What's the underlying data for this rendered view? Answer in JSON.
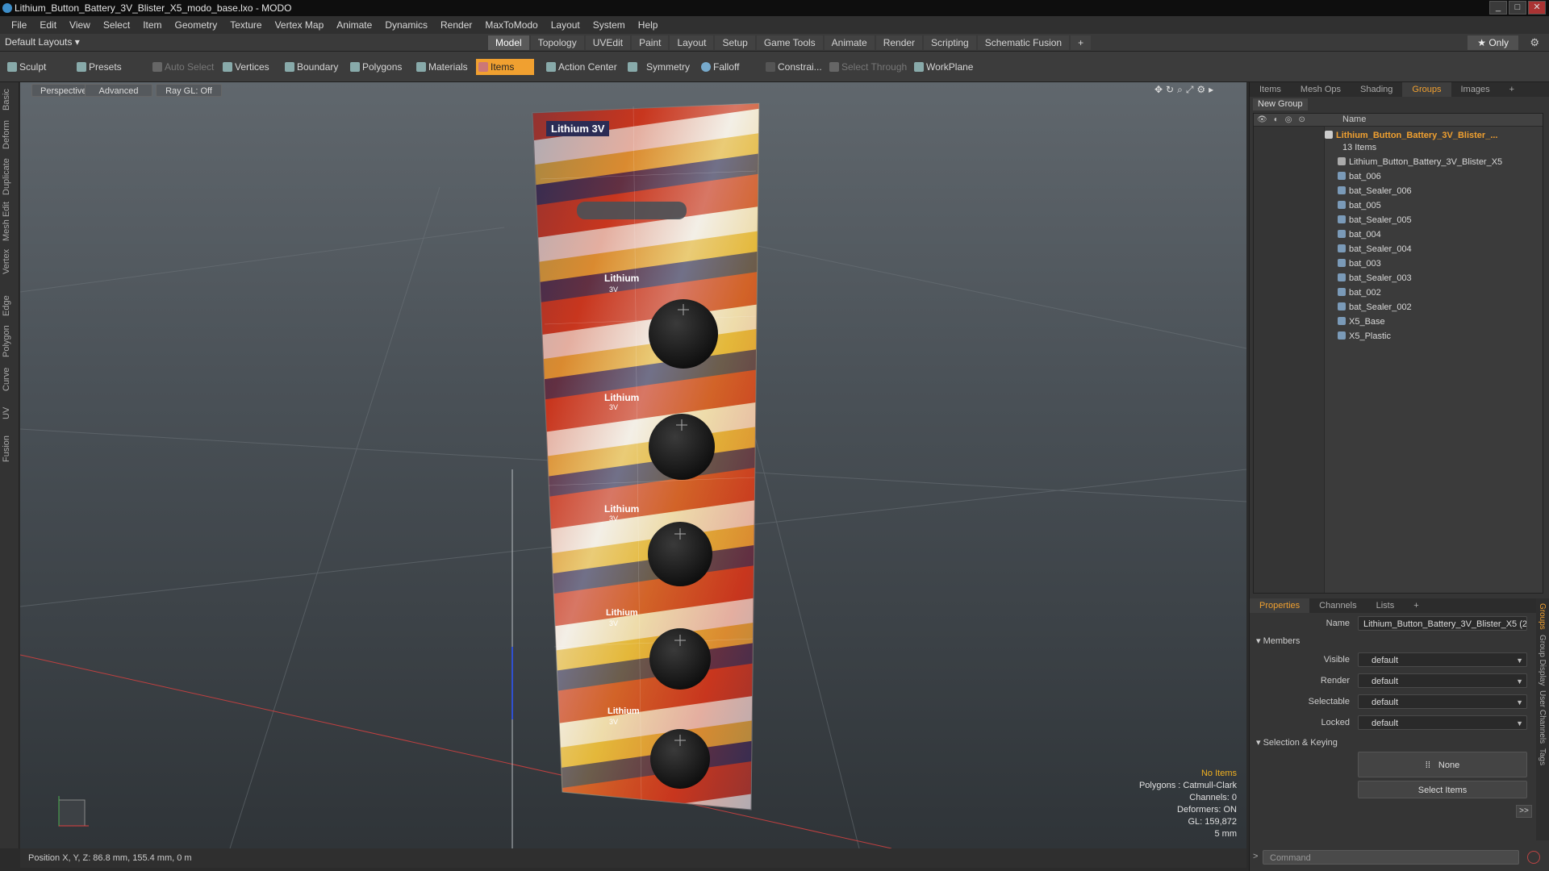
{
  "title": "Lithium_Button_Battery_3V_Blister_X5_modo_base.lxo - MODO",
  "menu": [
    "File",
    "Edit",
    "View",
    "Select",
    "Item",
    "Geometry",
    "Texture",
    "Vertex Map",
    "Animate",
    "Dynamics",
    "Render",
    "MaxToModo",
    "Layout",
    "System",
    "Help"
  ],
  "layout_dropdown": "Default Layouts ▾",
  "tabs": [
    "Model",
    "Topology",
    "UVEdit",
    "Paint",
    "Layout",
    "Setup",
    "Game Tools",
    "Animate",
    "Render",
    "Scripting",
    "Schematic Fusion"
  ],
  "only_label": "★ Only",
  "toolbar": {
    "sculpt": "Sculpt",
    "presets": "Presets",
    "auto_select": "Auto Select",
    "vertices": "Vertices",
    "boundary": "Boundary",
    "polygons": "Polygons",
    "materials": "Materials",
    "items": "Items",
    "action_center": "Action Center",
    "symmetry": "Symmetry",
    "falloff": "Falloff",
    "constraints": "Constrai...",
    "select_through": "Select Through",
    "workplane": "WorkPlane"
  },
  "left_tabs": [
    "Basic",
    "Deform",
    "Duplicate",
    "Mesh Edit",
    "Vertex",
    "Edge",
    "Polygon",
    "Curve",
    "UV",
    "Fusion"
  ],
  "viewport": {
    "perspective": "Perspective",
    "advanced": "Advanced",
    "raygl": "Ray GL: Off",
    "product_label": "Lithium  3V",
    "battery_label": "Lithium",
    "battery_volt": "3V",
    "info": {
      "no_items": "No Items",
      "polygons": "Polygons : Catmull-Clark",
      "channels": "Channels: 0",
      "deformers": "Deformers: ON",
      "gl": "GL: 159,872",
      "scale": "5 mm"
    }
  },
  "status": "Position X, Y, Z:  86.8 mm, 155.4 mm, 0 m",
  "panel_tabs": [
    "Items",
    "Mesh Ops",
    "Shading",
    "Groups",
    "Images"
  ],
  "new_group": "New Group",
  "tree": {
    "header": "Name",
    "group": "Lithium_Button_Battery_3V_Blister_...",
    "count": "13 Items",
    "items": [
      "Lithium_Button_Battery_3V_Blister_X5",
      "bat_006",
      "bat_Sealer_006",
      "bat_005",
      "bat_Sealer_005",
      "bat_004",
      "bat_Sealer_004",
      "bat_003",
      "bat_Sealer_003",
      "bat_002",
      "bat_Sealer_002",
      "X5_Base",
      "X5_Plastic"
    ]
  },
  "props_tabs": [
    "Properties",
    "Channels",
    "Lists"
  ],
  "props": {
    "name_label": "Name",
    "name_value": "Lithium_Button_Battery_3V_Blister_X5 (2",
    "members": "Members",
    "visible": "Visible",
    "render": "Render",
    "selectable": "Selectable",
    "locked": "Locked",
    "default": "default",
    "sel_keying": "Selection & Keying",
    "none": "None",
    "select_items": "Select Items"
  },
  "side_tabs": [
    "Groups",
    "Group Display",
    "User Channels",
    "Tags"
  ],
  "command_placeholder": "Command",
  "colors": {
    "accent": "#f0a030",
    "tree_group": "#f0a030"
  }
}
